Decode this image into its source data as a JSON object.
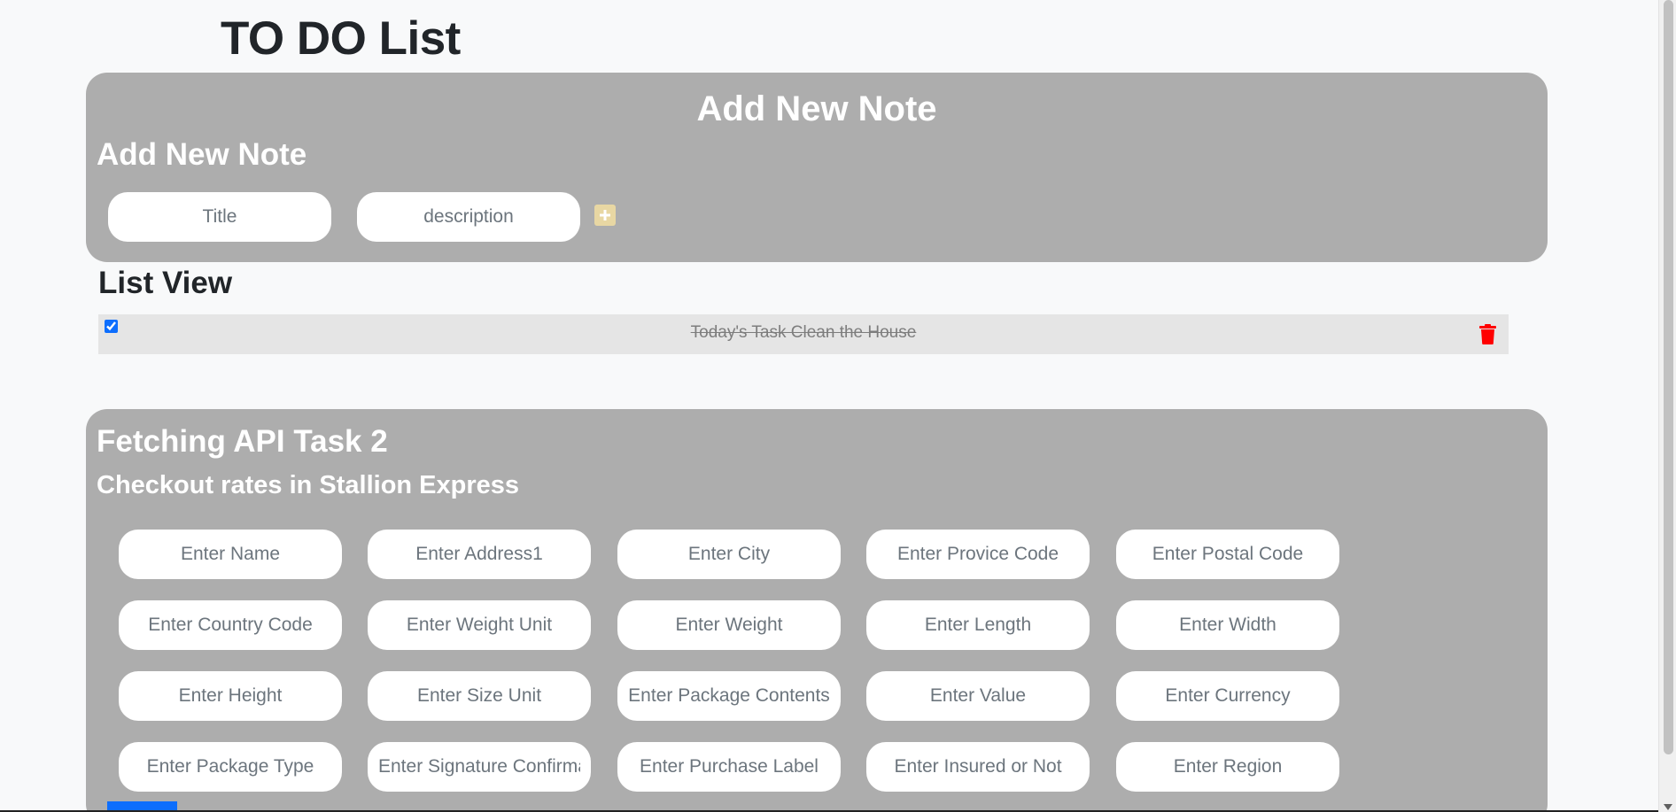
{
  "header": {
    "title": "TO DO List"
  },
  "add_note": {
    "panel_heading": "Add New Note",
    "form_heading": "Add New Note",
    "title_placeholder": "Title",
    "description_placeholder": "description",
    "add_icon": "plus-square-icon"
  },
  "list_view": {
    "heading": "List View",
    "items": [
      {
        "text": "Today's Task Clean the House",
        "checked": true,
        "delete_icon": "trash-icon"
      }
    ]
  },
  "api_task": {
    "heading": "Fetching API Task 2",
    "subheading": "Checkout rates in Stallion Express",
    "fields": [
      "Enter Name",
      "Enter Address1",
      "Enter City",
      "Enter Provice Code",
      "Enter Postal Code",
      "Enter Country Code",
      "Enter Weight Unit",
      "Enter Weight",
      "Enter Length",
      "Enter Width",
      "Enter Height",
      "Enter Size Unit",
      "Enter Package Contents",
      "Enter Value",
      "Enter Currency",
      "Enter Package Type",
      "Enter Signature Confirmation",
      "Enter Purchase Label",
      "Enter Insured or Not",
      "Enter Region"
    ]
  },
  "colors": {
    "panel": "#adadad",
    "page_bg": "#f8f9fa",
    "delete": "#ff0000",
    "add_button": "#e8d7a3",
    "submit": "#0d6efd"
  }
}
